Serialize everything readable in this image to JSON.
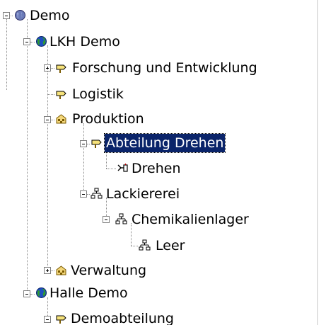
{
  "tree": {
    "nodes": [
      {
        "label": "Demo",
        "icon": "globe-gray-icon",
        "expanded": true,
        "selected": false
      },
      {
        "label": "LKH Demo",
        "icon": "globe-icon",
        "expanded": true,
        "selected": false
      },
      {
        "label": "Forschung und Entwicklung",
        "icon": "signpost-icon",
        "expanded": false,
        "selected": false
      },
      {
        "label": "Logistik",
        "icon": "signpost-icon",
        "expanded": null,
        "selected": false
      },
      {
        "label": "Produktion",
        "icon": "factory-icon",
        "expanded": true,
        "selected": false
      },
      {
        "label": "Abteilung Drehen",
        "icon": "signpost-icon",
        "expanded": true,
        "selected": true
      },
      {
        "label": "Drehen",
        "icon": "lathe-icon",
        "expanded": null,
        "selected": false
      },
      {
        "label": "Lackiererei",
        "icon": "org-chart-icon",
        "expanded": true,
        "selected": false
      },
      {
        "label": "Chemikalienlager",
        "icon": "org-chart-icon",
        "expanded": true,
        "selected": false
      },
      {
        "label": "Leer",
        "icon": "org-chart-icon",
        "expanded": null,
        "selected": false
      },
      {
        "label": "Verwaltung",
        "icon": "factory-icon",
        "expanded": false,
        "selected": false
      },
      {
        "label": "Halle Demo",
        "icon": "globe-icon",
        "expanded": true,
        "selected": false
      },
      {
        "label": "Demoabteilung",
        "icon": "signpost-icon",
        "expanded": true,
        "selected": false
      }
    ]
  },
  "colors": {
    "selection_bg": "#0a246a",
    "selection_text": "#ffffff",
    "signpost_yellow": "#f6e27a",
    "globe_green": "#2f9b2f",
    "globe_blue": "#1f4fbf"
  }
}
